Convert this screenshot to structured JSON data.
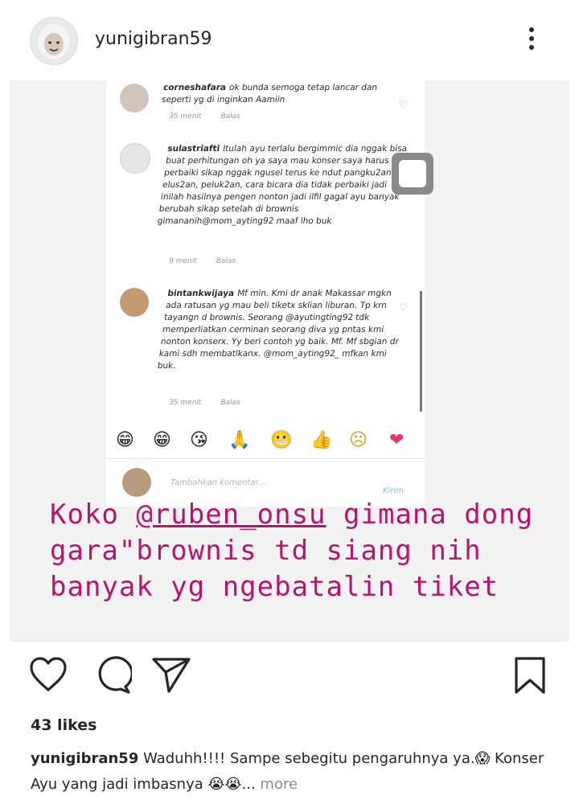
{
  "header": {
    "username": "yunigibran59"
  },
  "screenshot": {
    "comments": [
      {
        "user": "corneshafara",
        "text": "ok bunda semoga tetap lancar dan seperti yg di inginkan Aamiin",
        "time": "35 menit",
        "reply": "Balas"
      },
      {
        "user": "sulastriafti",
        "text": "Itulah ayu terlalu bergimmic dia nggak bisa buat perhitungan oh ya saya mau konser saya harus perbaiki sikap nggak ngusel terus ke ndut pangku2an, elus2an, peluk2an, cara bicara dia tidak perbaiki jadi inilah hasilnya pengen nonton jadi ilfil gagal ayu banyak berubah sikap setelah di brownis gimananih@mom_ayting92 maaf lho buk",
        "time": "9 menit",
        "reply": "Balas"
      },
      {
        "user": "bintankwijaya",
        "text": "Mf min. Kmi dr anak Makassar mgkn ada ratusan yg mau beli tiketx sklian liburan. Tp krn tayangn d brownis. Seorang @ayutingting92 tdk memperliatkan cerminan seorang diva yg pntas kmi nonton konserx. Yy beri contoh yg baik. Mf. Mf sbgian dr kami sdh membatlkanx. @mom_ayting92_ mfkan kmi buk.",
        "time": "35 menit",
        "reply": "Balas"
      }
    ],
    "emojis": [
      "😁",
      "😁",
      "😘",
      "🙏",
      "😬",
      "👍",
      "☹",
      "❤"
    ],
    "add_comment_placeholder": "Tambahkan komentar...",
    "send_label": "Kirim"
  },
  "overlay_text": {
    "prefix": "Koko ",
    "mention": "@ruben_onsu",
    "rest": " gimana dong gara\"brownis td siang nih banyak yg ngebatalin tiket"
  },
  "likes": "43 likes",
  "caption": {
    "username": "yunigibran59",
    "text": " Waduhh!!!! Sampe sebegitu pengaruhnya ya.😱 Konser Ayu yang jadi imbasnya 😭😭...",
    "more": " more"
  },
  "colors": {
    "overlay_text": "#b5166a",
    "link": "#3897f0",
    "text": "#262626"
  },
  "icons": [
    "heart-icon",
    "comment-icon",
    "share-icon",
    "bookmark-icon",
    "more-icon"
  ]
}
